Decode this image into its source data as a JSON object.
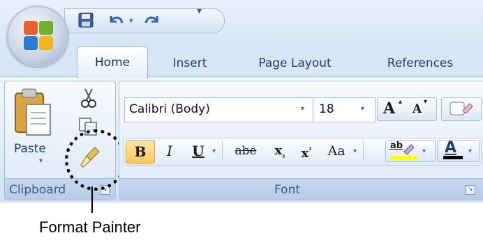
{
  "quick_access": {
    "save_icon": "save-icon",
    "undo_icon": "undo-icon",
    "redo_icon": "redo-icon",
    "customize_icon": "customize-qat-icon"
  },
  "tabs": [
    {
      "label": "Home"
    },
    {
      "label": "Insert"
    },
    {
      "label": "Page Layout"
    },
    {
      "label": "References"
    }
  ],
  "clipboard": {
    "group_label": "Clipboard",
    "paste_label": "Paste"
  },
  "font": {
    "group_label": "Font",
    "font_name": "Calibri (Body)",
    "font_size": "18",
    "bold_label": "B",
    "italic_label": "I",
    "underline_label": "U",
    "strike_label": "abe",
    "subscript_label": "x",
    "superscript_label": "x",
    "change_case_label": "Aa",
    "grow_label": "A",
    "shrink_label": "A",
    "highlight_label": "ab",
    "font_color_label": "A",
    "highlight_color": "#ffff00",
    "font_color": "#000000"
  },
  "callout": {
    "text": "Format Painter"
  }
}
